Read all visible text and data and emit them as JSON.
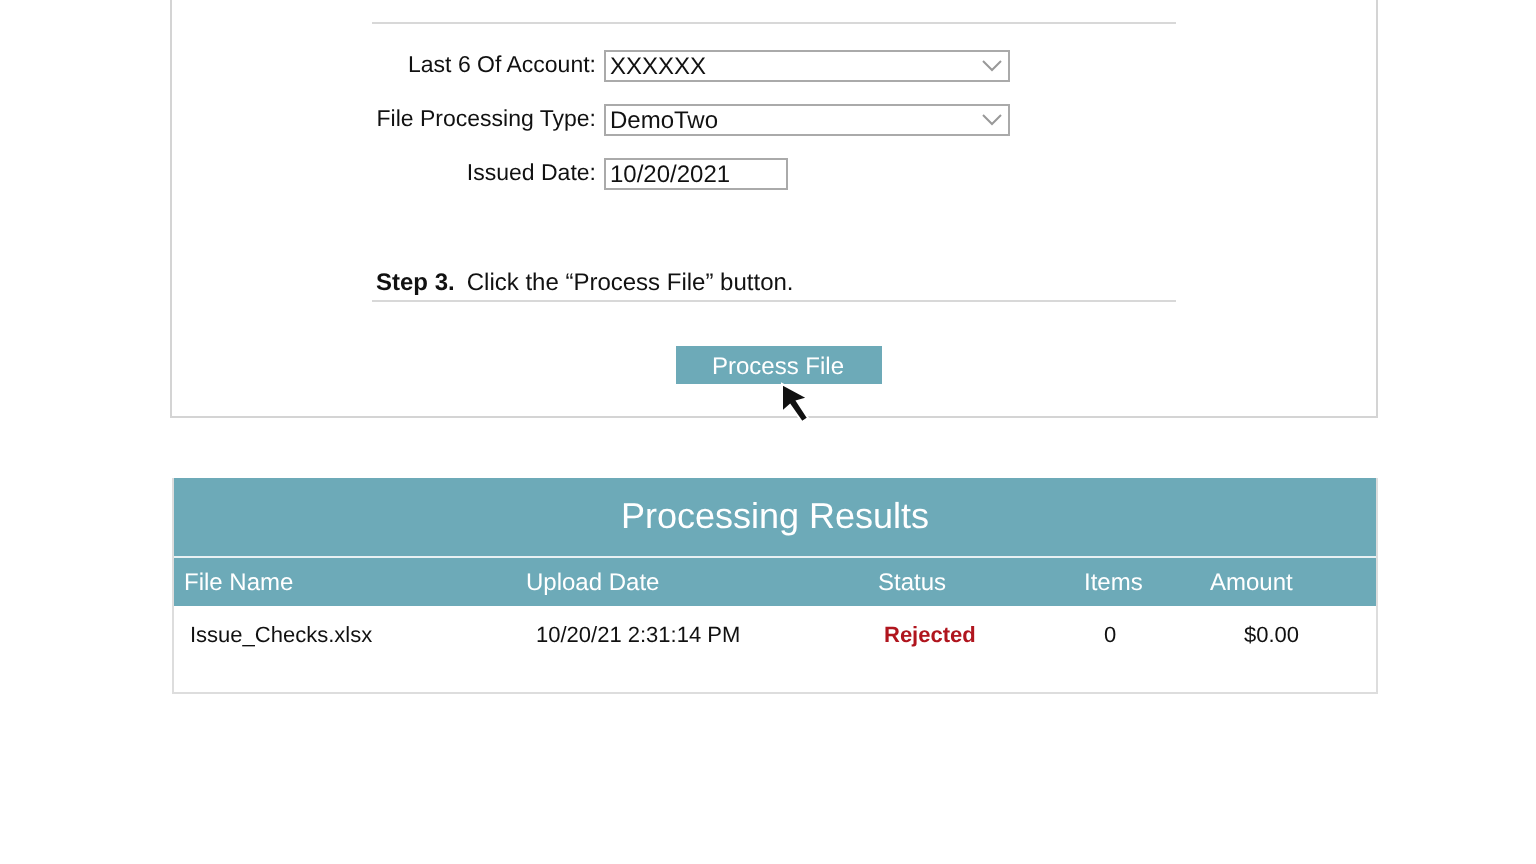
{
  "form": {
    "fields": [
      {
        "kind": "select",
        "label": "Last 6 Of Account:",
        "value": "XXXXXX"
      },
      {
        "kind": "select",
        "label": "File Processing Type:",
        "value": "DemoTwo"
      },
      {
        "kind": "text",
        "label": "Issued Date:",
        "value": "10/20/2021"
      }
    ],
    "step": {
      "number": "Step 3.",
      "instruction": "Click the “Process File” button."
    },
    "button": "Process File"
  },
  "results": {
    "title": "Processing Results",
    "columns": [
      "File Name",
      "Upload Date",
      "Status",
      "Items",
      "Amount"
    ],
    "rows": [
      {
        "file_name": "Issue_Checks.xlsx",
        "upload_date": "10/20/21 2:31:14 PM",
        "status": "Rejected",
        "items": "0",
        "amount": "$0.00"
      }
    ]
  }
}
